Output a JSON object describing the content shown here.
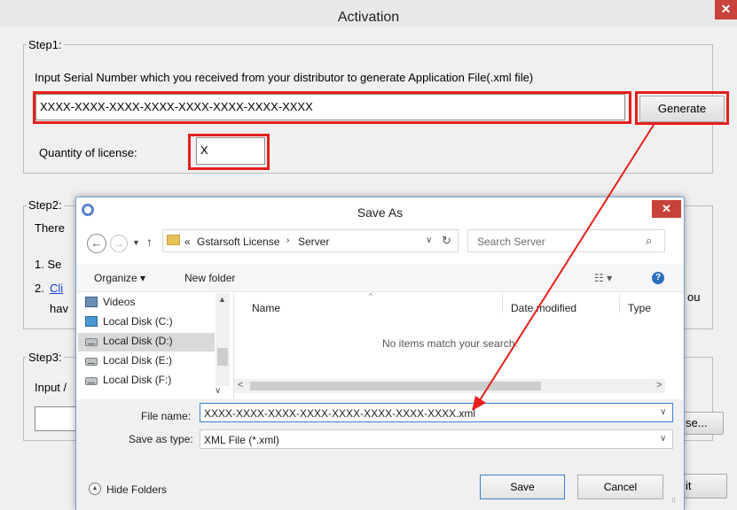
{
  "window": {
    "title": "Activation",
    "close_glyph": "✕"
  },
  "step1": {
    "legend": "Step1:",
    "instruction": "Input Serial Number which you received from your distributor to generate Application File(.xml file)",
    "serial_value": "XXXX-XXXX-XXXX-XXXX-XXXX-XXXX-XXXX-XXXX",
    "generate_label": "Generate",
    "quantity_label": "Quantity of license:",
    "quantity_value": "X"
  },
  "step2": {
    "legend": "Step2:",
    "line1": "There",
    "item1": "1. Se",
    "item2_num": "2.",
    "item2_link": "Cli",
    "item2_cont": "hav",
    "trailing": "ou"
  },
  "step3": {
    "legend": "Step3:",
    "line1": "Input /",
    "browse_label": "se...",
    "exit_label": "it"
  },
  "save_as": {
    "title": "Save As",
    "breadcrumb_prefix": "«",
    "breadcrumb": [
      "Gstarsoft License",
      "Server"
    ],
    "search_placeholder": "Search Server",
    "organize_label": "Organize ▾",
    "new_folder_label": "New folder",
    "view_label": "☷ ▾",
    "help_label": "?",
    "nav_items": [
      "Videos",
      "Local Disk (C:)",
      "Local Disk (D:)",
      "Local Disk (E:)",
      "Local Disk (F:)"
    ],
    "columns": [
      "Name",
      "Date modified",
      "Type"
    ],
    "empty_message": "No items match your search.",
    "file_name_label": "File name:",
    "file_name_value": "XXXX-XXXX-XXXX-XXXX-XXXX-XXXX-XXXX-XXXX.xml",
    "save_type_label": "Save as type:",
    "save_type_value": "XML File (*.xml)",
    "hide_folders_label": "Hide Folders",
    "save_label": "Save",
    "cancel_label": "Cancel"
  },
  "annotation": {
    "color": "#e5201d"
  }
}
